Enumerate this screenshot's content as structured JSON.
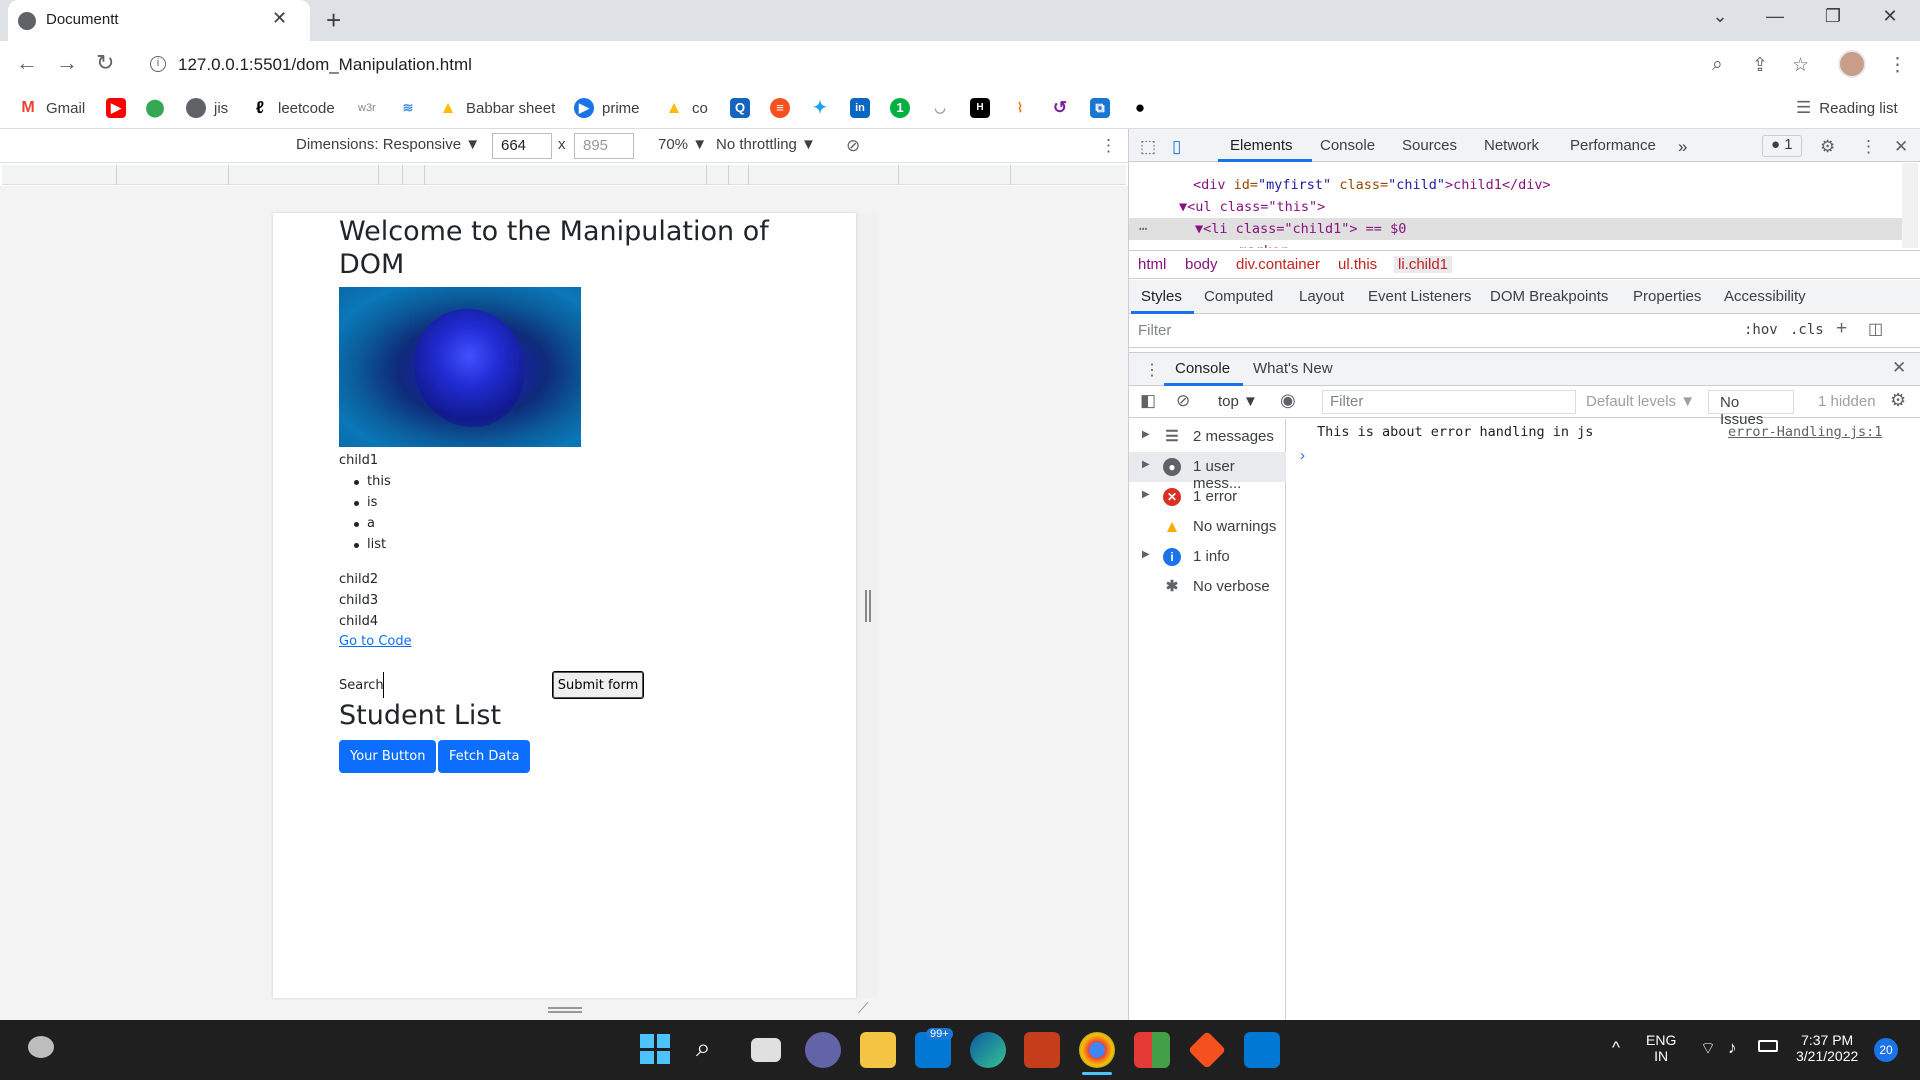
{
  "browser": {
    "tab_title": "Documentt",
    "url": "127.0.0.1:5501/dom_Manipulation.html",
    "reading_list": "Reading list",
    "bookmarks": [
      "Gmail",
      "jis",
      "leetcode",
      "w3r",
      "Babbar sheet",
      "prime",
      "co"
    ]
  },
  "device_toolbar": {
    "dimensions_label": "Dimensions: Responsive ▼",
    "width": "664",
    "height": "895",
    "x_sep": "x",
    "zoom": "70% ▼",
    "throttling": "No throttling ▼"
  },
  "page": {
    "title": "Welcome to the Manipulation of DOM",
    "child1": "child1",
    "list_items": [
      "this",
      "is",
      "a",
      "list"
    ],
    "child2": "child2",
    "child3": "child3",
    "child4": "child4",
    "link": "Go to Code",
    "search_label": "Search:",
    "submit": "Submit form",
    "student_list": "Student List",
    "button1": "Your Button",
    "button2": "Fetch Data"
  },
  "devtools": {
    "tabs": [
      "Elements",
      "Console",
      "Sources",
      "Network",
      "Performance",
      "»"
    ],
    "issues_badge": "1",
    "dom_lines": {
      "line1_tag_open": "<div ",
      "line1_id_attr": "id=",
      "line1_id_val": "\"myfirst\"",
      "line1_class_attr": " class=",
      "line1_class_val": "\"child\"",
      "line1_text": ">child1</div>",
      "line2": "▼<ul class=\"this\">",
      "line3": "▼<li class=\"child1\"> == $0",
      "line4": "::marker"
    },
    "breadcrumbs": [
      "html",
      "body",
      "div.container",
      "ul.this",
      "li.child1"
    ],
    "styles_tabs": [
      "Styles",
      "Computed",
      "Layout",
      "Event Listeners",
      "DOM Breakpoints",
      "Properties",
      "Accessibility"
    ],
    "styles_filter": "Filter",
    "hov": ":hov",
    "cls": ".cls",
    "drawer_tabs": [
      "Console",
      "What's New"
    ],
    "console_context": "top ▼",
    "console_filter": "Filter",
    "default_levels": "Default levels ▼",
    "no_issues": "No Issues",
    "hidden": "1 hidden",
    "sidebar": [
      "2 messages",
      "1 user mess...",
      "1 error",
      "No warnings",
      "1 info",
      "No verbose"
    ],
    "message": "This is about error handling in js",
    "source": "error-Handling.js:1",
    "prompt": "›"
  },
  "taskbar": {
    "lang1": "ENG",
    "lang2": "IN",
    "time": "7:37 PM",
    "date": "3/21/2022",
    "notifications": "20",
    "mail_badge": "99+"
  },
  "colors": {
    "accent": "#1a73e8",
    "bootstrap_primary": "#0d6efd",
    "error": "#d93025",
    "warning": "#f9ab00",
    "info": "#1a73e8"
  }
}
